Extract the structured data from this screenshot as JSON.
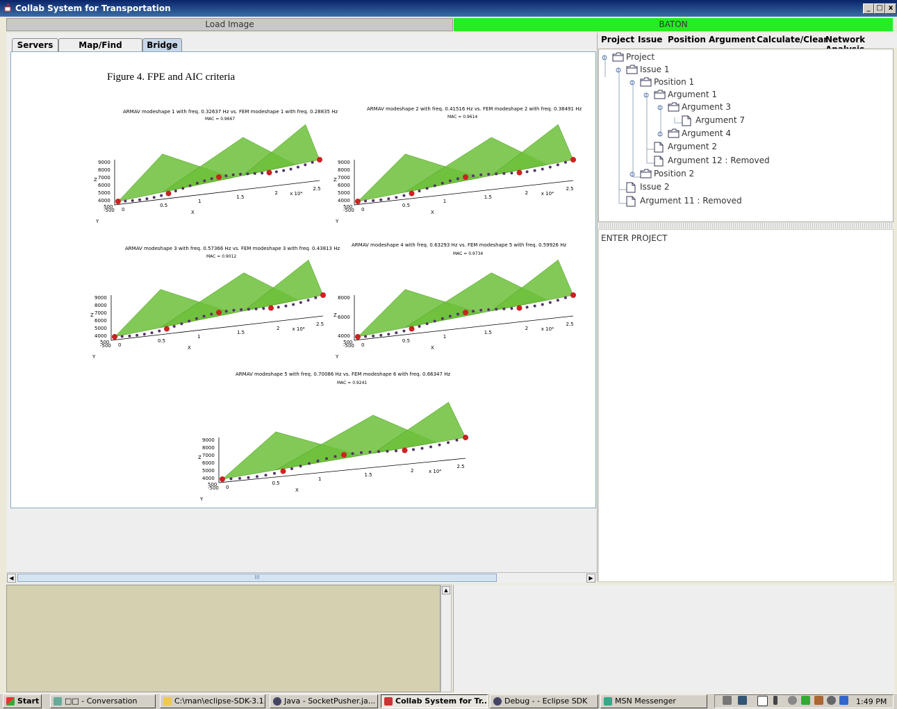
{
  "window": {
    "title": "Collab System for Transportation",
    "min": "_",
    "max": "□",
    "close": "x"
  },
  "topbar": {
    "load_image": "Load Image",
    "baton": "BATON"
  },
  "tabs": [
    {
      "label": "Servers",
      "selected": false
    },
    {
      "label": "Map/Find Stations",
      "selected": false
    },
    {
      "label": "Bridge",
      "selected": true
    }
  ],
  "document": {
    "caption": "Figure 4. FPE and AIC criteria",
    "plots": [
      {
        "title": "ARMAV modeshape 1 with freq. 0.32637 Hz vs. FEM modeshape 1 with freq. 0.28835 Hz",
        "mac": "MAC = 0.9667",
        "zticks": [
          "9000",
          "8000",
          "7000",
          "6000",
          "5000",
          "4000"
        ],
        "z": "Z",
        "x": "X",
        "y": "Y",
        "xticks": [
          "0",
          "0.5",
          "1",
          "1.5",
          "2",
          "2.5"
        ],
        "xunit": "x 10⁴",
        "yticks": [
          "500",
          "-500"
        ]
      },
      {
        "title": "ARMAV modeshape 2 with freq. 0.41516 Hz vs. FEM modeshape 2 with freq. 0.38491 Hz",
        "mac": "MAC = 0.9614",
        "zticks": [
          "9000",
          "8000",
          "7000",
          "6000",
          "5000",
          "4000"
        ],
        "z": "Z",
        "x": "X",
        "y": "Y",
        "xticks": [
          "0",
          "0.5",
          "1",
          "1.5",
          "2",
          "2.5"
        ],
        "xunit": "x 10⁴",
        "yticks": [
          "500",
          "-500"
        ]
      },
      {
        "title": "ARMAV modeshape 3 with freq. 0.57366 Hz vs. FEM modeshape 3 with freq. 0.43813 Hz",
        "mac": "MAC = 0.9012",
        "zticks": [
          "9000",
          "8000",
          "7000",
          "6000",
          "5000",
          "4000"
        ],
        "z": "Z",
        "x": "X",
        "y": "Y",
        "xticks": [
          "0",
          "0.5",
          "1",
          "1.5",
          "2",
          "2.5"
        ],
        "xunit": "x 10⁴",
        "yticks": [
          "500",
          "-500"
        ]
      },
      {
        "title": "ARMAV modeshape 4 with freq. 0.63293 Hz vs. FEM modeshape 5 with freq. 0.59926 Hz",
        "mac": "MAC = 0.9734",
        "zticks": [
          "8000",
          "6000",
          "4000"
        ],
        "z": "Z",
        "x": "X",
        "y": "Y",
        "xticks": [
          "0",
          "0.5",
          "1",
          "1.5",
          "2",
          "2.5"
        ],
        "xunit": "x 10⁴",
        "yticks": [
          "500",
          "-500"
        ]
      },
      {
        "title": "ARMAV modeshape 5 with freq. 0.70086 Hz vs. FEM modeshape 6 with freq. 0.66347 Hz",
        "mac": "MAC = 0.9241",
        "zticks": [
          "9000",
          "8000",
          "7000",
          "6000",
          "5000",
          "4000"
        ],
        "z": "Z",
        "x": "X",
        "y": "Y",
        "xticks": [
          "0",
          "0.5",
          "1",
          "1.5",
          "2",
          "2.5"
        ],
        "xunit": "x 10⁴",
        "yticks": [
          "500",
          "-500"
        ]
      }
    ]
  },
  "scrollbar": {
    "left": "◀",
    "right": "▶",
    "grip": "III"
  },
  "menubar": [
    "Project",
    "Issue",
    "Position",
    "Argument",
    "Calculate/Clear",
    "Network Analysis"
  ],
  "tree": {
    "nodes": [
      {
        "label": "Project",
        "type": "folder"
      },
      {
        "label": "Issue 1",
        "type": "folder"
      },
      {
        "label": "Position 1",
        "type": "folder"
      },
      {
        "label": "Argument 1",
        "type": "folder"
      },
      {
        "label": "Argument 3",
        "type": "folder"
      },
      {
        "label": "Argument 7",
        "type": "file"
      },
      {
        "label": "Argument 4",
        "type": "folder"
      },
      {
        "label": "Argument 2",
        "type": "file"
      },
      {
        "label": "Argument 12 : Removed",
        "type": "file"
      },
      {
        "label": "Position 2",
        "type": "folder"
      },
      {
        "label": "Issue 2",
        "type": "file"
      },
      {
        "label": "Argument 11 : Removed",
        "type": "file"
      }
    ]
  },
  "entry": {
    "label": "ENTER PROJECT"
  },
  "taskbar": {
    "start": "Start",
    "items": [
      {
        "label": "□□ - Conversation",
        "active": false
      },
      {
        "label": "C:\\man\\eclipse-SDK-3.1...",
        "active": false
      },
      {
        "label": "Java - SocketPusher.ja...",
        "active": false
      },
      {
        "label": "Collab System for Tr...",
        "active": true
      },
      {
        "label": "Debug - - Eclipse SDK",
        "active": false
      },
      {
        "label": "MSN Messenger",
        "active": false
      }
    ],
    "clock": "1:49 PM"
  },
  "colors": {
    "baton": "#22ee22",
    "title_gradient_start": "#0a246a",
    "console_bg": "#d4d0b0",
    "plot_green": "#66bb33",
    "plot_marker": "#cc2222"
  }
}
